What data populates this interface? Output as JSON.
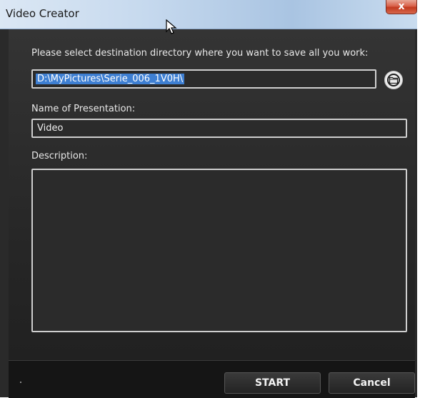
{
  "window": {
    "title": "Video Creator",
    "close_label": "x"
  },
  "form": {
    "directory_label": "Please select destination directory where you want to save all you work:",
    "directory_value": "D:\\MyPictures\\Serie_006_1V0H\\",
    "name_label": "Name of Presentation:",
    "name_value": "Video",
    "description_label": "Description:",
    "description_value": ""
  },
  "footer": {
    "start_label": "START",
    "cancel_label": "Cancel"
  },
  "icons": {
    "browse": "folder-icon",
    "close": "close-icon",
    "cursor": "mouse-cursor-icon"
  },
  "colors": {
    "selection": "#3e7fd2",
    "background": "#2a2a2a",
    "close_button": "#d9614a"
  }
}
